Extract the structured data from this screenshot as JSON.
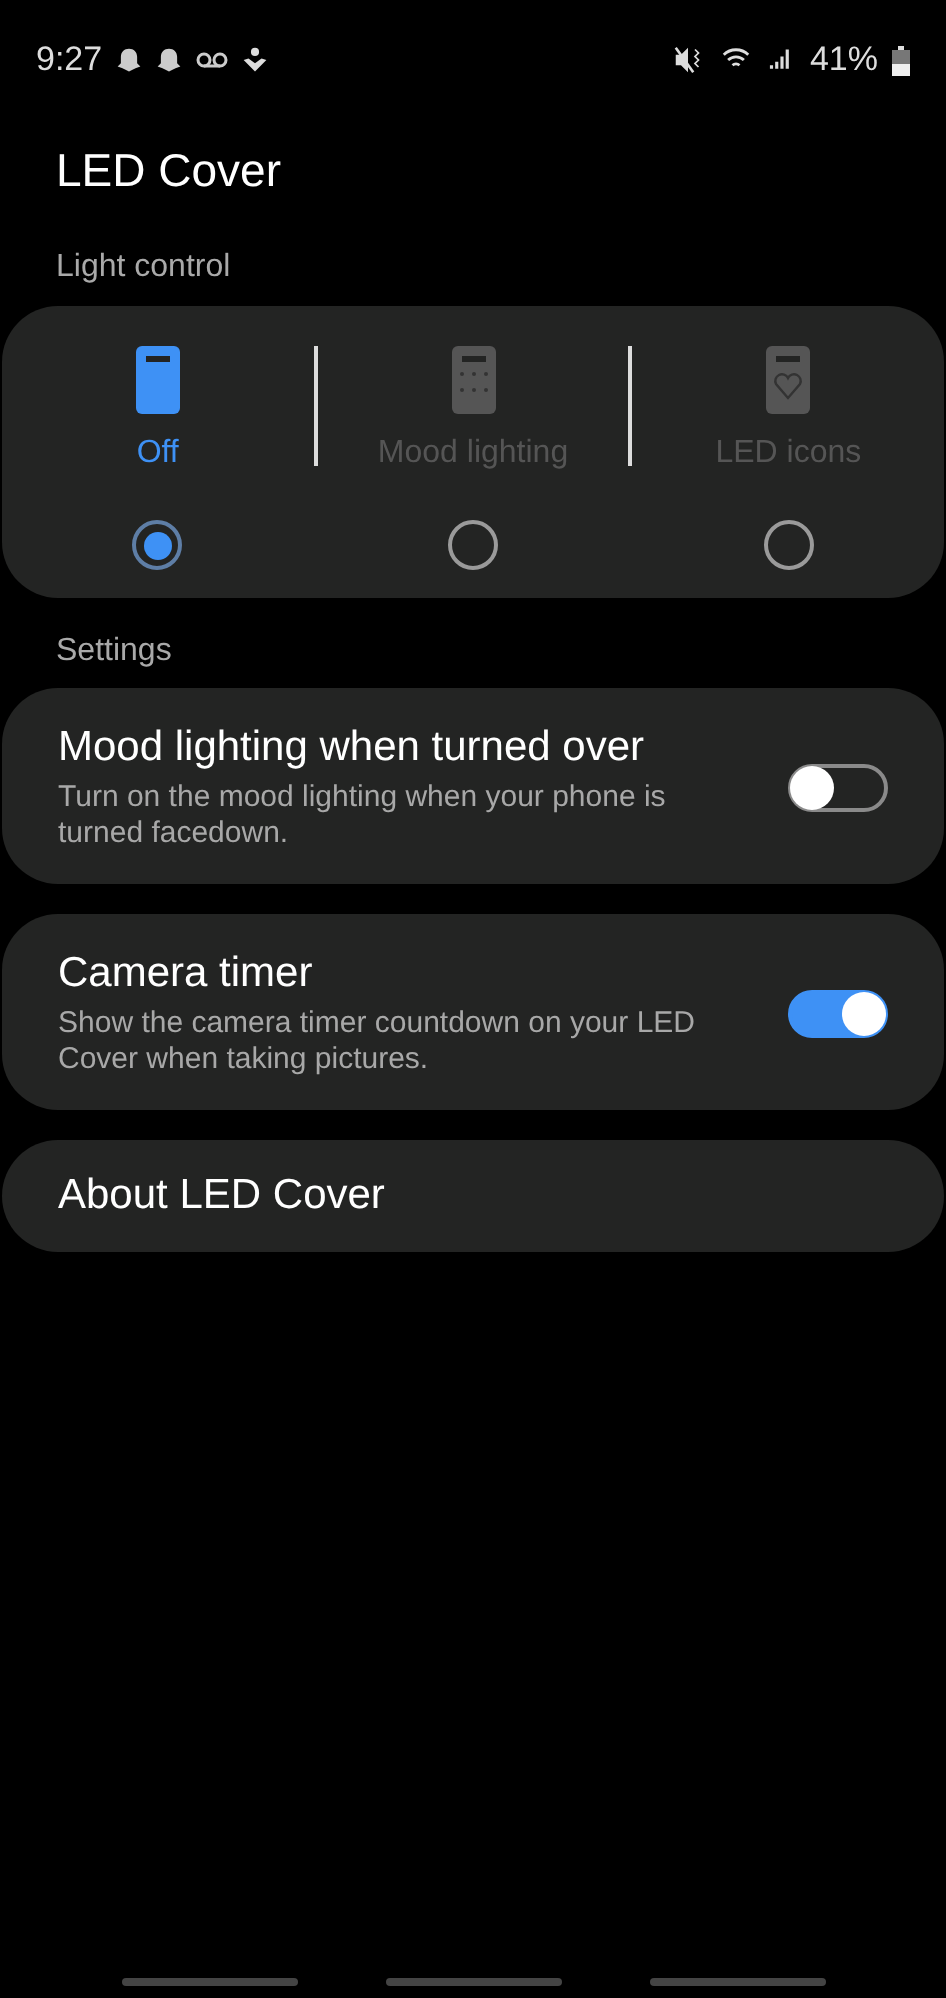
{
  "status_bar": {
    "time": "9:27",
    "battery": "41%"
  },
  "title": "LED Cover",
  "light_control": {
    "heading": "Light control",
    "options": [
      {
        "kind": "off",
        "label": "Off",
        "selected": true
      },
      {
        "kind": "mood",
        "label": "Mood lighting",
        "selected": false
      },
      {
        "kind": "icons",
        "label": "LED icons",
        "selected": false
      }
    ]
  },
  "settings": {
    "heading": "Settings",
    "items": [
      {
        "title": "Mood lighting when turned over",
        "description": "Turn on the mood lighting when your phone is turned facedown.",
        "on": false
      },
      {
        "title": "Camera timer",
        "description": "Show the camera timer countdown on your LED Cover when taking pictures.",
        "on": true
      }
    ]
  },
  "about": {
    "title": "About LED Cover"
  }
}
